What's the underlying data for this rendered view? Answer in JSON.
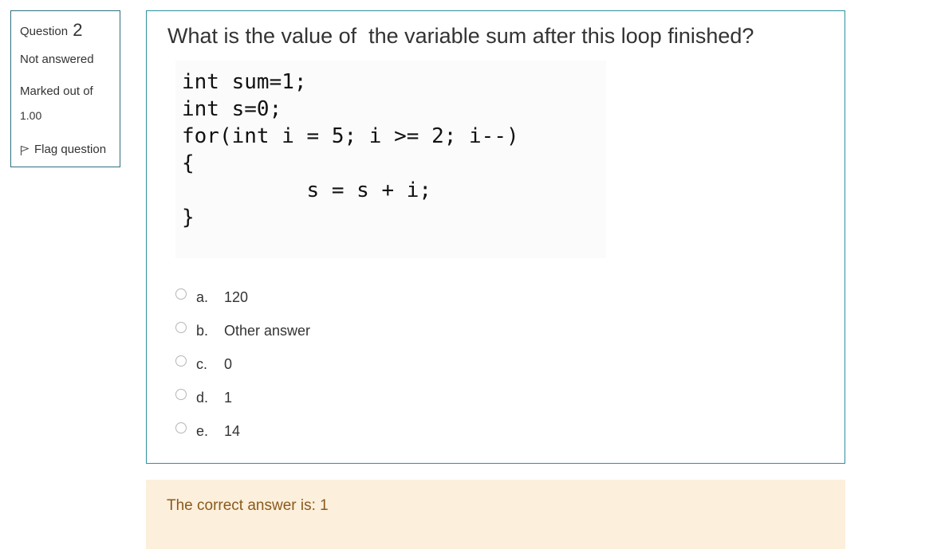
{
  "info": {
    "question_label": "Question",
    "question_number": "2",
    "status": "Not answered",
    "marked_out_of_label": "Marked out of",
    "marked_out_of_value": "1.00",
    "flag_label": "Flag question",
    "flag_icon": "flag-icon"
  },
  "question": {
    "text": "What is the value of  the variable sum after this loop finished?",
    "code": [
      "int sum=1;",
      "int s=0;",
      "for(int i = 5; i >= 2; i--)",
      "{",
      "          s = s + i;",
      "}"
    ]
  },
  "answers": [
    {
      "letter": "a.",
      "text": "120",
      "selected": false
    },
    {
      "letter": "b.",
      "text": "Other answer",
      "selected": false
    },
    {
      "letter": "c.",
      "text": "0",
      "selected": false
    },
    {
      "letter": "d.",
      "text": "1",
      "selected": false
    },
    {
      "letter": "e.",
      "text": "14",
      "selected": false
    }
  ],
  "feedback": {
    "text": "The correct answer is: 1"
  },
  "colors": {
    "info_border": "#2f6f7e",
    "question_border": "#2f8f9e",
    "feedback_bg": "#fcefdc",
    "feedback_text": "#8a5a1c"
  }
}
